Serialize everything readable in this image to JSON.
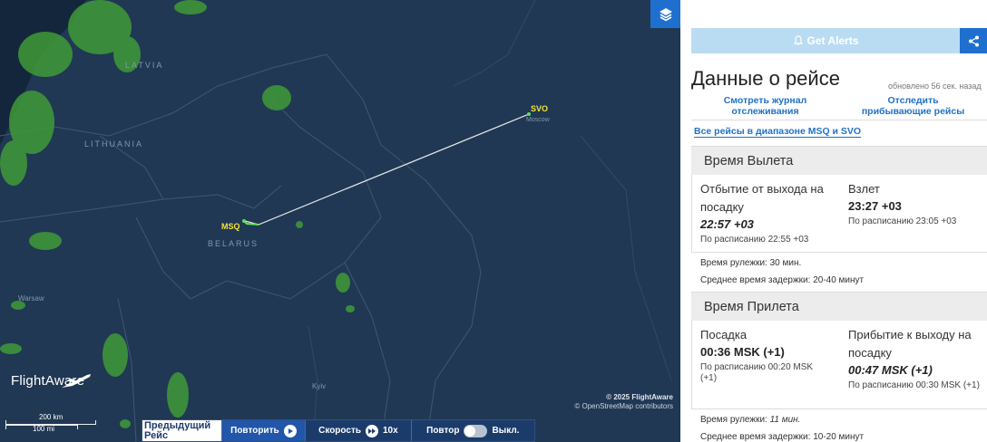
{
  "map": {
    "country_labels": {
      "latvia": "LATVIA",
      "lithuania": "LITHUANIA",
      "belarus": "BELARUS",
      "warsaw": "Warsaw",
      "kyiv": "Kyiv",
      "moscow": "Moscow"
    },
    "origin_code": "MSQ",
    "destination_code": "SVO",
    "logo_text": "FlightAware",
    "scale_km": "200 km",
    "scale_mi": "100 mi",
    "attribution_line1": "© 2025 FlightAware",
    "attribution_line2": "© OpenStreetMap contributors",
    "route_color": "#e8e8e8",
    "weather_color": "#3f9a37"
  },
  "playback": {
    "prev_flight": "Предыдущий Рейс",
    "replay": "Повторить",
    "speed": "Скорость",
    "speed_value": "10x",
    "loop": "Повтор",
    "loop_state": "Выкл."
  },
  "panel": {
    "get_alerts": "Get Alerts",
    "title": "Данные о рейсе",
    "updated": "обновлено 56 сек. назад",
    "link_track_log": "Смотреть журнал отслеживания",
    "link_track_arrivals": "Отследить прибывающие рейсы",
    "link_all_flights": "Все рейсы в диапазоне MSQ и SVO",
    "departure": {
      "heading": "Время Вылета",
      "gate_label": "Отбытие от выхода на посадку",
      "gate_time": "22:57 +03",
      "gate_scheduled": "По расписанию 22:55 +03",
      "takeoff_label": "Взлет",
      "takeoff_time": "23:27 +03",
      "takeoff_scheduled": "По расписанию 23:05 +03",
      "taxi_time": "Время рулежки: 30 мин.",
      "avg_delay": "Среднее время задержки: 20-40 минут"
    },
    "arrival": {
      "heading": "Время Прилета",
      "landing_label": "Посадка",
      "landing_time": "00:36 MSK (+1)",
      "landing_scheduled": "По расписанию 00:20 MSK (+1)",
      "gate_label": "Прибытие к выходу на посадку",
      "gate_time": "00:47 MSK (+1)",
      "gate_scheduled": "По расписанию 00:30 MSK (+1)",
      "taxi_label": "Время рулежки:",
      "taxi_value": "11 мин.",
      "avg_delay": "Среднее время задержки: 10-20 минут"
    }
  }
}
